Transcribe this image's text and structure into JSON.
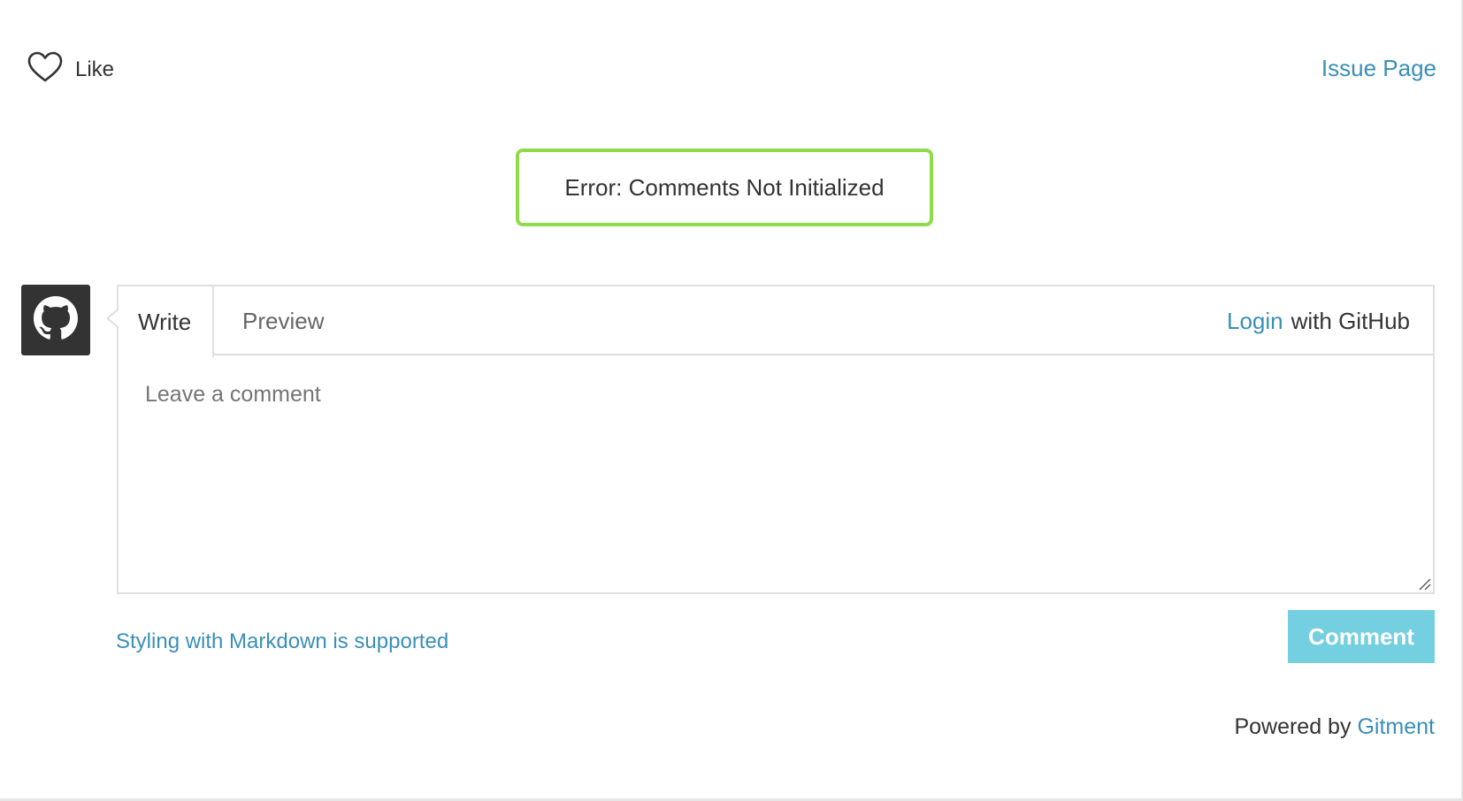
{
  "header": {
    "like_label": "Like",
    "issue_page_label": "Issue Page"
  },
  "error": {
    "message": "Error: Comments Not Initialized"
  },
  "editor": {
    "tabs": [
      {
        "label": "Write",
        "active": true
      },
      {
        "label": "Preview",
        "active": false
      }
    ],
    "login_label": "Login",
    "login_suffix": "with GitHub",
    "comment_placeholder": "Leave a comment",
    "comment_value": ""
  },
  "footer": {
    "markdown_hint": "Styling with Markdown is supported",
    "comment_button": "Comment",
    "powered_by": "Powered by",
    "powered_link": "Gitment"
  },
  "icons": {
    "like": "heart-icon",
    "avatar": "github-icon",
    "resize": "resize-grip-icon"
  },
  "colors": {
    "link": "#3a8fb7",
    "error_border": "#8fdc4a",
    "comment_button_bg": "#74cfe0",
    "avatar_bg": "#333333"
  }
}
